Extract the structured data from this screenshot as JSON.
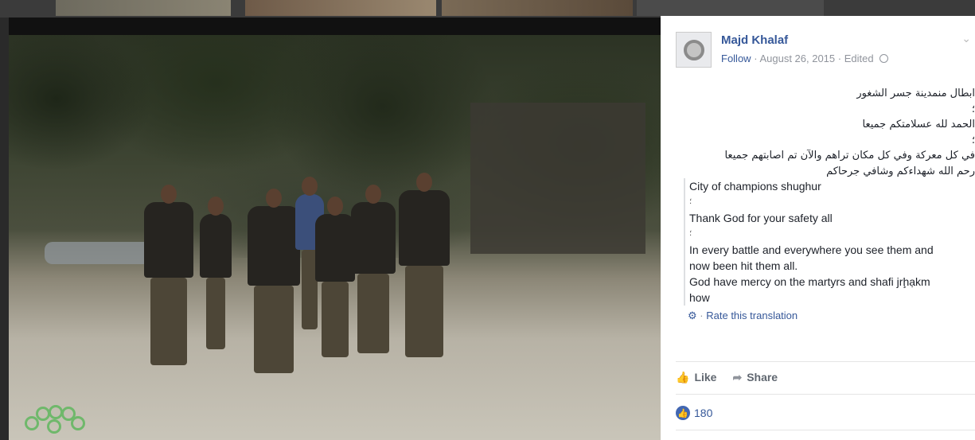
{
  "post": {
    "author": "Majd Khalaf",
    "follow": "Follow",
    "date": "August 26, 2015",
    "edited": "Edited",
    "separator": "·",
    "arabic_lines": [
      "ابطال منمدينة جسر الشغور",
      "؛",
      "الحمد لله عسلامتكم جميعا",
      "؛",
      "في كل معركة وفي كل مكان تراهم والآن تم اصابتهم جميعا",
      "رحم الله شهداءكم وشافي جرحاكم"
    ],
    "translation_lines": [
      "City of champions shughur",
      "؛",
      "Thank God for your safety all",
      "؛",
      "In every battle and everywhere you see them and",
      "now been hit them all.",
      "God have mercy on the martyrs and shafi jrḩạkm",
      "how"
    ],
    "rate_translation": "Rate this translation"
  },
  "actions": {
    "like": "Like",
    "share": "Share"
  },
  "reactions": {
    "count": "180"
  },
  "icons": {
    "options": "chevron-down-icon",
    "privacy": "globe-icon",
    "settings": "gear-icon",
    "like": "thumbs-up-icon",
    "share": "share-arrow-icon",
    "reaction": "like-reaction-icon"
  },
  "colors": {
    "link": "#365899",
    "meta": "#90949c",
    "text": "#1d2129",
    "like_reaction": "#4267b2",
    "logo_green": "#6fb86b"
  }
}
